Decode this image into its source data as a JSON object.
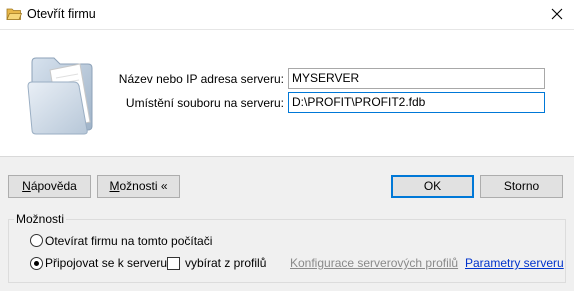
{
  "window": {
    "title": "Otevřít firmu"
  },
  "form": {
    "server_label": "Název nebo IP adresa serveru:",
    "server_value": "MYSERVER",
    "path_label": "Umístění souboru na serveru:",
    "path_value": "D:\\PROFIT\\PROFIT2.fdb"
  },
  "buttons": {
    "help_prefix": "",
    "help_mnemonic": "N",
    "help_rest": "ápověda",
    "options_mnemonic": "M",
    "options_rest": "ožnosti «",
    "ok": "OK",
    "cancel": "Storno"
  },
  "options": {
    "group_title": "Možnosti",
    "radio_local": "Otevírat firmu na tomto počítači",
    "radio_server": "Připojovat se k serveru",
    "radio_server_selected": true,
    "checkbox_profile": "vybírat z profilů",
    "checkbox_profile_checked": false,
    "link_config": "Konfigurace serverových profilů",
    "link_params": "Parametry serveru"
  }
}
